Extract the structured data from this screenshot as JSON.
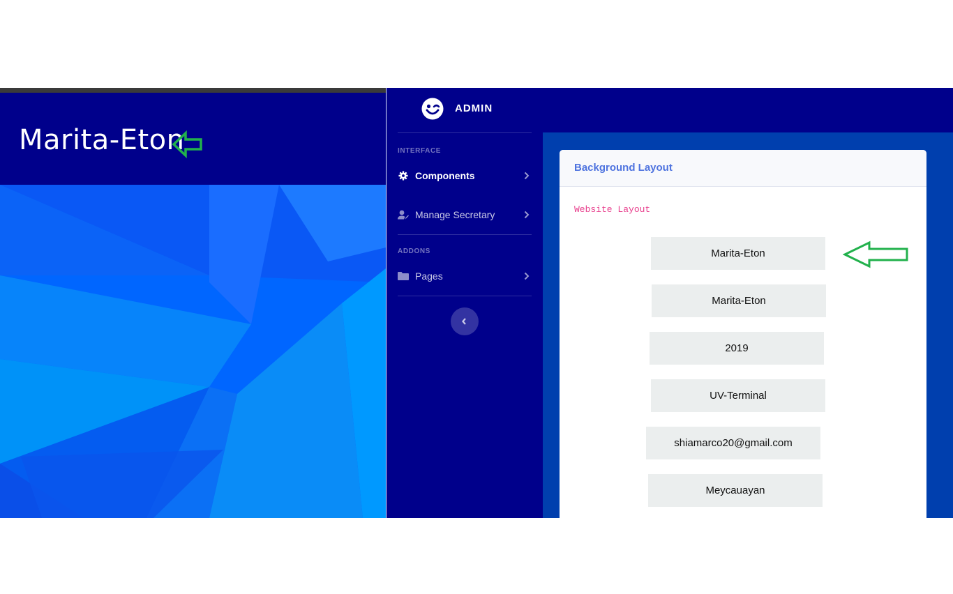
{
  "preview": {
    "title": "Marita-Eton",
    "colors": {
      "header": "#00008b",
      "topbar": "#3a3a3a",
      "annotation_arrow": "#22b14c"
    },
    "annotation_icon": "green-outline-arrow-left"
  },
  "sidebar": {
    "brand": {
      "text": "ADMIN",
      "icon": "smile-wink-icon"
    },
    "sections": [
      {
        "heading": "INTERFACE"
      },
      {
        "heading": "ADDONS"
      }
    ],
    "items": [
      {
        "label": "Components",
        "icon": "gear-icon",
        "active": true
      },
      {
        "label": "Manage Secretary",
        "icon": "user-edit-icon",
        "active": false
      },
      {
        "label": "Pages",
        "icon": "folder-icon",
        "active": false
      }
    ],
    "collapse_icon": "chevron-left-icon",
    "colors": {
      "background": "#00008b"
    }
  },
  "main": {
    "card": {
      "title": "Background Layout",
      "code_label": "Website Layout",
      "fields": [
        {
          "value": "Marita-Eton"
        },
        {
          "value": "Marita-Eton"
        },
        {
          "value": "2019"
        },
        {
          "value": "UV-Terminal"
        },
        {
          "value": "shiamarco20@gmail.com"
        },
        {
          "value": "Meycauayan"
        }
      ]
    },
    "colors": {
      "content_bg": "#003fae",
      "card_title": "#4e73df",
      "code": "#e83e8c"
    }
  }
}
